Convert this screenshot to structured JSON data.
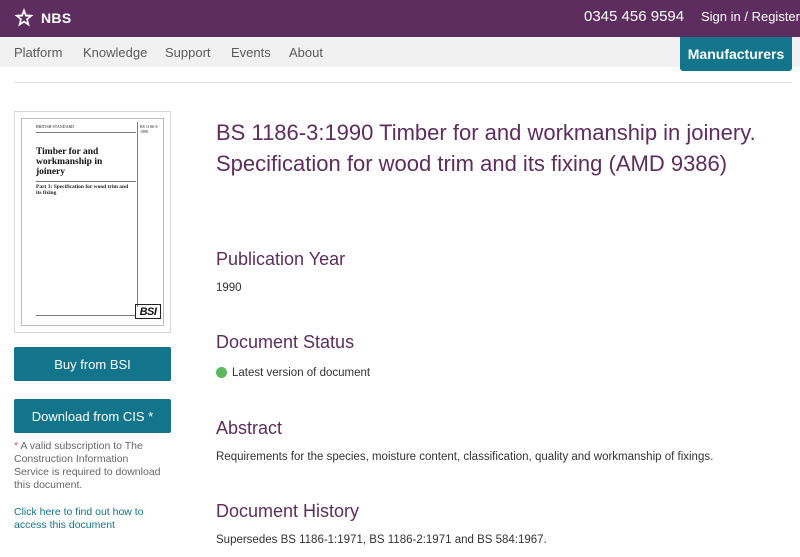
{
  "header": {
    "logo_text": "NBS",
    "logo_icon": "star-icon",
    "phone": "0345 456 9594",
    "signin_label": "Sign in / Register",
    "bg_color": "#5e2d5f"
  },
  "nav": {
    "items": [
      "Platform",
      "Knowledge",
      "Support",
      "Events",
      "About"
    ],
    "cta_label": "Manufacturers",
    "cta_color": "#12758b"
  },
  "cover": {
    "header_left": "BRITISH STANDARD",
    "header_right": "BS 1186-3:\n1990",
    "title": "Timber for and workmanship in joinery",
    "subtitle": "Part 3: Specification for wood trim and its fixing",
    "logo": "BSI"
  },
  "sidebar": {
    "buy_label": "Buy from BSI",
    "download_label": "Download from CIS *",
    "note_star": "*",
    "note_text": "A valid subscription to The Construction Information Service is required to download this document.",
    "link_text": "Click here to find out how to access this document"
  },
  "document": {
    "title": "BS 1186-3:1990 Timber for and workmanship in joinery. Specification for wood trim and its fixing (AMD 9386)",
    "publication_year_heading": "Publication Year",
    "publication_year": "1990",
    "status_heading": "Document Status",
    "status": "Latest version of document",
    "status_color": "#5cb85c",
    "abstract_heading": "Abstract",
    "abstract": "Requirements for the species, moisture content, classification, quality and workmanship of fixings.",
    "history_heading": "Document History",
    "history": "Supersedes BS 1186-1:1971, BS 1186-2:1971 and BS 584:1967."
  }
}
